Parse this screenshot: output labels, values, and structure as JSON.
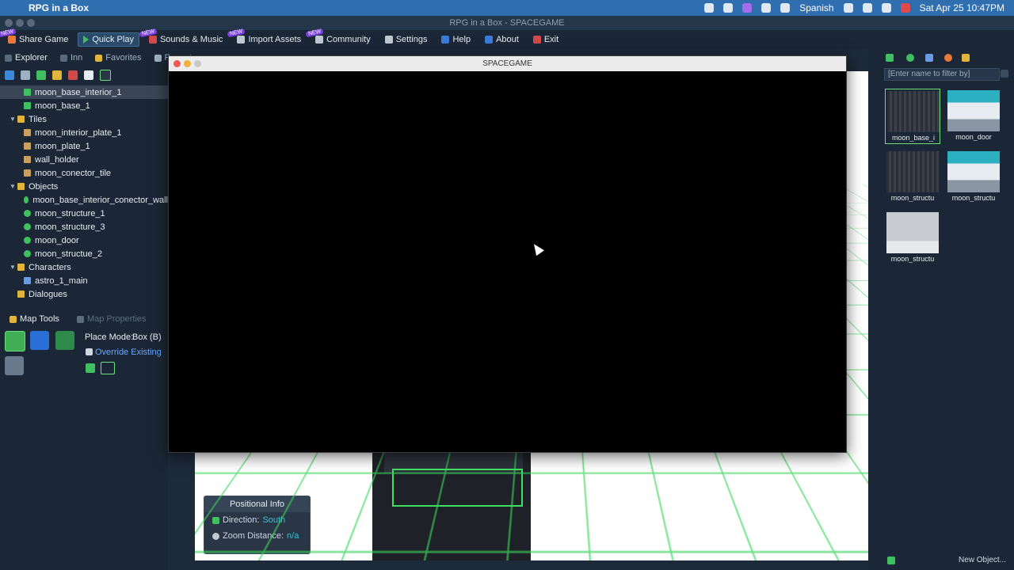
{
  "mac_menubar": {
    "app_name": "RPG in a Box",
    "language": "Spanish",
    "datetime": "Sat Apr 25  10:47PM"
  },
  "window": {
    "title": "RPG in a Box - SPACEGAME"
  },
  "top_menu": [
    {
      "label": "Share Game",
      "new": true
    },
    {
      "label": "Quick Play",
      "new": false
    },
    {
      "label": "Sounds & Music",
      "new": true
    },
    {
      "label": "Import Assets",
      "new": true
    },
    {
      "label": "Community",
      "new": true
    },
    {
      "label": "Settings",
      "new": false
    },
    {
      "label": "Help",
      "new": false
    },
    {
      "label": "About",
      "new": false
    },
    {
      "label": "Exit",
      "new": false
    }
  ],
  "left_tabs": [
    {
      "label": "Explorer"
    },
    {
      "label": "Inn"
    },
    {
      "label": "Favorites"
    },
    {
      "label": "Recent"
    }
  ],
  "tree": [
    {
      "label": "moon_base_interior_1",
      "type": "map",
      "indent": 1,
      "selected": true
    },
    {
      "label": "moon_base_1",
      "type": "map",
      "indent": 1
    },
    {
      "label": "Tiles",
      "type": "folder",
      "indent": 0
    },
    {
      "label": "moon_interior_plate_1",
      "type": "tile",
      "indent": 1
    },
    {
      "label": "moon_plate_1",
      "type": "tile",
      "indent": 1
    },
    {
      "label": "wall_holder",
      "type": "tile",
      "indent": 1
    },
    {
      "label": "moon_conector_tile",
      "type": "tile",
      "indent": 1
    },
    {
      "label": "Objects",
      "type": "folder",
      "indent": 0
    },
    {
      "label": "moon_base_interior_conector_wall",
      "type": "object",
      "indent": 1
    },
    {
      "label": "moon_structure_1",
      "type": "object",
      "indent": 1
    },
    {
      "label": "moon_structure_3",
      "type": "object",
      "indent": 1
    },
    {
      "label": "moon_door",
      "type": "object",
      "indent": 1
    },
    {
      "label": "moon_structue_2",
      "type": "object",
      "indent": 1
    },
    {
      "label": "Characters",
      "type": "folder",
      "indent": 0
    },
    {
      "label": "astro_1_main",
      "type": "character",
      "indent": 1
    },
    {
      "label": "Dialogues",
      "type": "folder",
      "indent": 0
    }
  ],
  "map_tools": {
    "tab_tools": "Map Tools",
    "tab_props": "Map Properties",
    "place_mode_label": "Place Mode:",
    "place_mode_value": "Box (B)",
    "override_label": "Override Existing"
  },
  "game_window": {
    "title": "SPACEGAME"
  },
  "positional_info": {
    "title": "Positional Info",
    "direction_label": "Direction:",
    "direction_value": "South",
    "zoom_label": "Zoom Distance:",
    "zoom_value": "n/a"
  },
  "right_panel": {
    "filter_placeholder": "[Enter name to filter by]",
    "thumbnails": [
      {
        "label": "moon_base_i",
        "style": "dark"
      },
      {
        "label": "moon_door",
        "style": "door"
      },
      {
        "label": "moon_structu",
        "style": "dark"
      },
      {
        "label": "moon_structu",
        "style": "door"
      },
      {
        "label": "moon_structu",
        "style": "plain"
      }
    ],
    "new_object": "New Object..."
  }
}
